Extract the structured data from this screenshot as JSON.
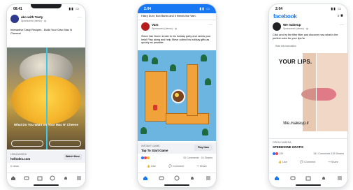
{
  "colors": {
    "facebook_blue": "#1877f2",
    "split_line": "#3ac7e8"
  },
  "phone1": {
    "time": "08:41",
    "page_name": "ako with Tasty",
    "page_sub": "Sponsored (demo) · ",
    "caption": "Interactive Tasty Recipes - Build Your Own Mac N Cheese!",
    "video_text": "What Do You Want on Your Mac N' Cheese",
    "option_left": "",
    "option_right": "",
    "cta_site": "HOLIDAYBOX",
    "cta_title": "hellodeo.com",
    "cta_button": "Watch More",
    "views": "6 views"
  },
  "phone2": {
    "time": "2:04",
    "top_strip": "Hilary Duhr, Bob Banks and 6 friends like Vam.",
    "page_name": "Vam",
    "page_sub": "Sponsored (demo) · ",
    "caption": "Steve Van Doren is late to his holiday party and needs your help! Play along and help Steve collect his holiday gifts as quickly as possible.",
    "cta_site": "INSTANT GAME",
    "cta_title": "Tap To Start Game",
    "cta_button": "Play Now",
    "reactions_count": "",
    "comments": "33 Comments",
    "shares": "24 Shares",
    "like": "Like",
    "comment": "Comment",
    "share": "Share"
  },
  "phone3": {
    "time": "2:04",
    "logo": "facebook",
    "page_name": "We makeup",
    "page_sub": "Sponsored (demo) · ",
    "caption": "Click and try the filter filter and discover now what is the perfect color for your lips! ●",
    "translate": "Rate this translation",
    "headline": "YOUR LIPS.",
    "brand": "We.makeup.it",
    "cta_site": "OPEN CAMERA",
    "cta_title": "SPEDIZIONE GRATIS",
    "reactions_count": "13K",
    "comments": "341 Comments",
    "shares": "155 Shares",
    "like": "Like",
    "comment": "Comment",
    "share": "Share"
  },
  "icons": [
    "home-icon",
    "video-icon",
    "marketplace-icon",
    "groups-icon",
    "bell-icon",
    "menu-icon"
  ]
}
